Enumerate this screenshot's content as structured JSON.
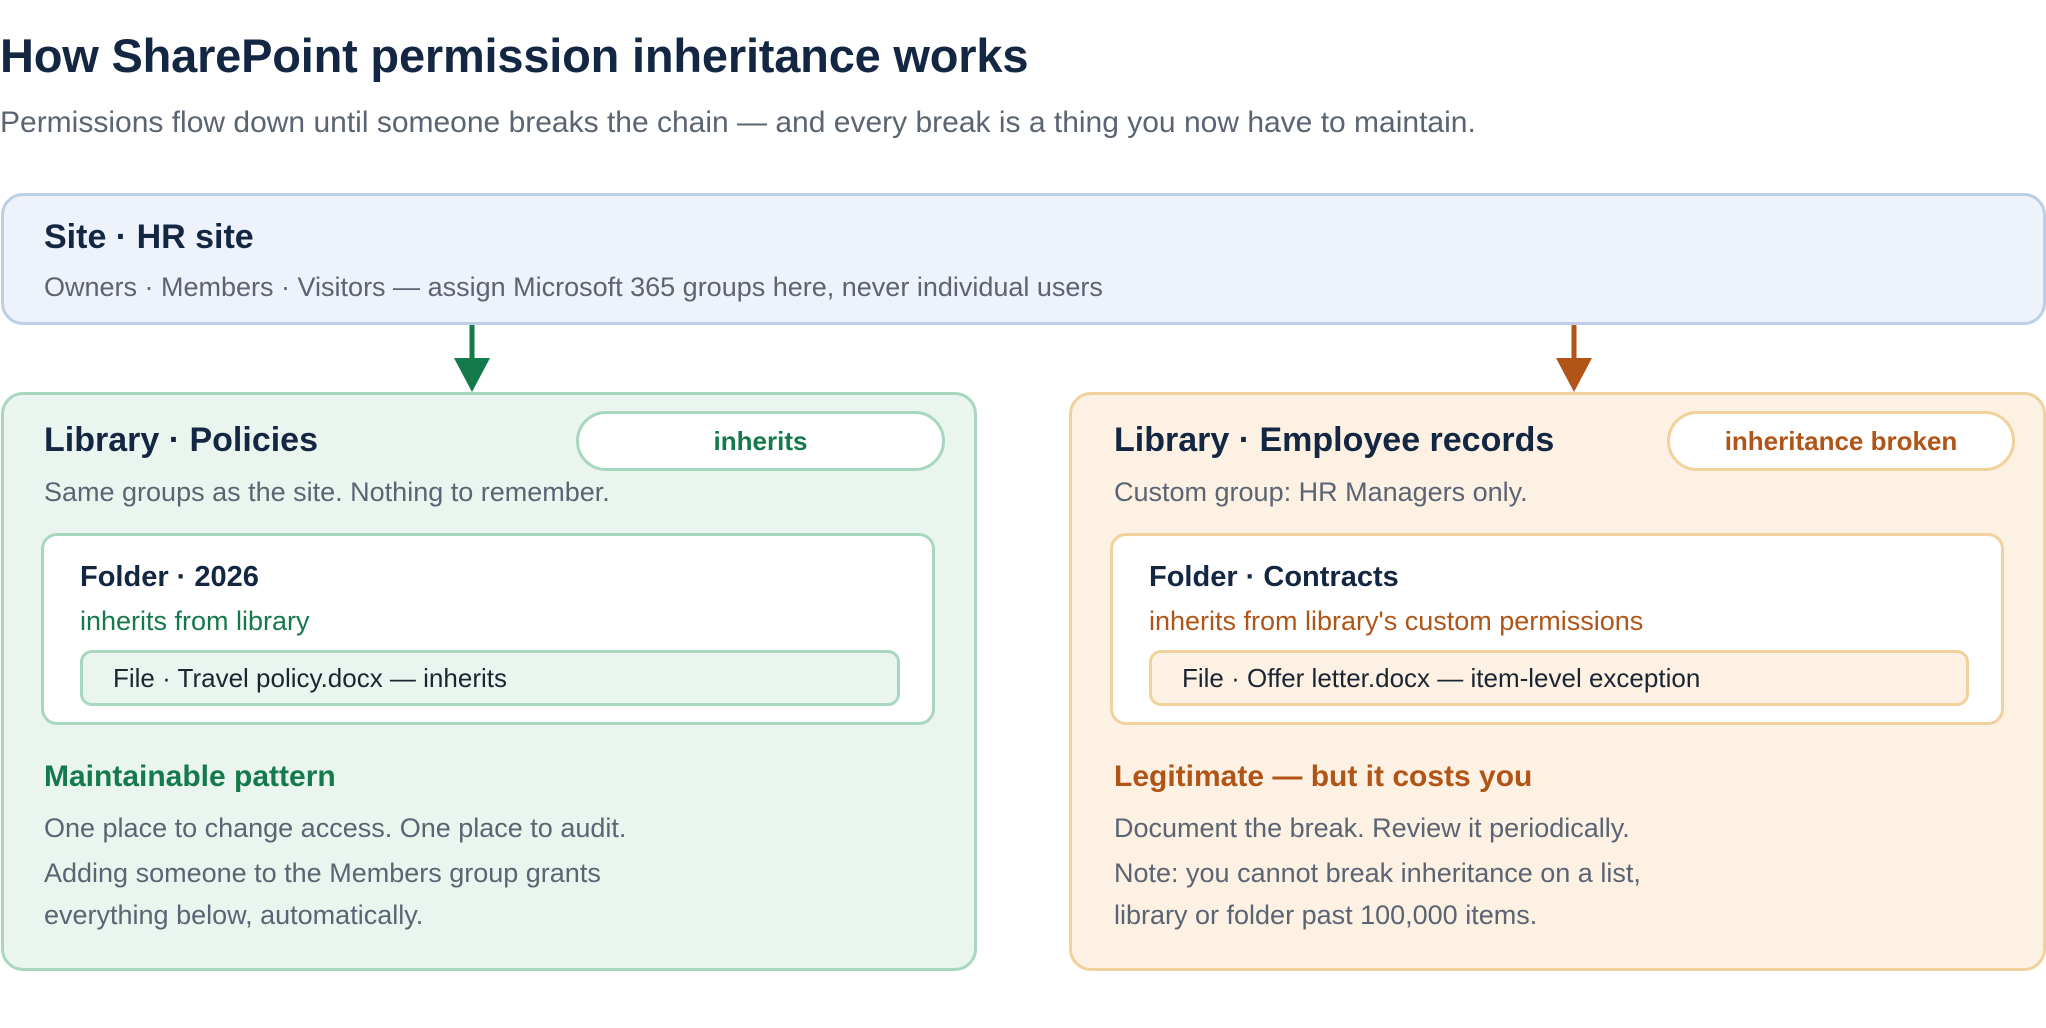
{
  "title": "How SharePoint permission inheritance works",
  "subtitle": "Permissions flow down until someone breaks the chain — and every break is a thing you now have to maintain.",
  "site": {
    "heading": "Site · HR site",
    "description": "Owners · Members · Visitors — assign Microsoft 365 groups here, never individual users"
  },
  "left": {
    "heading": "Library · Policies",
    "badge": "inherits",
    "description": "Same groups as the site. Nothing to remember.",
    "folder": {
      "heading": "Folder · 2026",
      "status": "inherits from library",
      "file": "File · Travel policy.docx — inherits"
    },
    "pattern_heading": "Maintainable pattern",
    "note_1": "One place to change access. One place to audit.",
    "note_2_line1": "Adding someone to the Members group grants",
    "note_2_line2": "everything below, automatically."
  },
  "right": {
    "heading": "Library · Employee records",
    "badge": "inheritance broken",
    "description": "Custom group: HR Managers only.",
    "folder": {
      "heading": "Folder · Contracts",
      "status": "inherits from library's custom permissions",
      "file": "File · Offer letter.docx — item-level exception"
    },
    "pattern_heading": "Legitimate — but it costs you",
    "note_1": "Document the break. Review it periodically.",
    "note_2_line1": "Note: you cannot break inheritance on a list,",
    "note_2_line2": "library or folder past 100,000 items."
  },
  "colors": {
    "inherit_accent": "#147a4b",
    "broken_accent": "#b05517",
    "site_fill": "#edf2fb",
    "inherit_fill": "#ebf5ef",
    "broken_fill": "#fdf1e3"
  }
}
